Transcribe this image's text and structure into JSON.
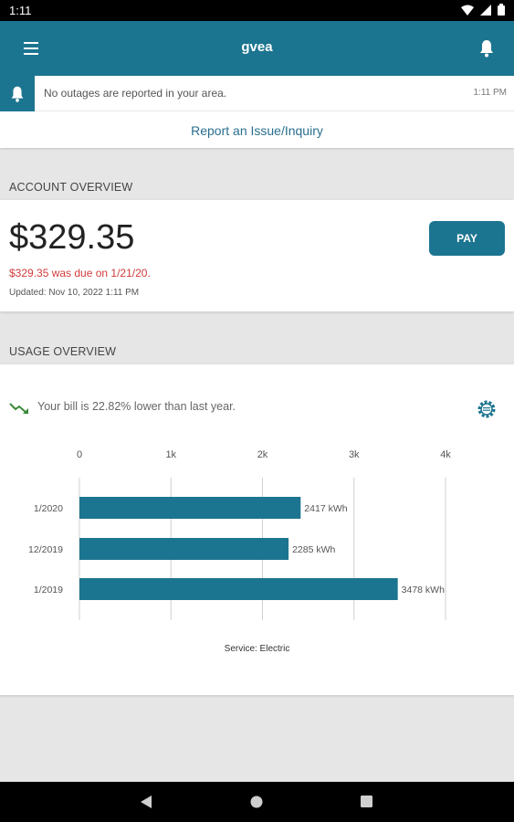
{
  "status_bar": {
    "time": "1:11"
  },
  "app_bar": {
    "title": "gvea"
  },
  "alert": {
    "message": "No outages are reported in your area.",
    "time": "1:11 PM"
  },
  "report_link": "Report an Issue/Inquiry",
  "account": {
    "section_title": "ACCOUNT OVERVIEW",
    "amount": "$329.35",
    "due_text": "$329.35 was due on 1/21/20.",
    "updated": "Updated:  Nov 10, 2022 1:11 PM",
    "pay_label": "PAY"
  },
  "usage": {
    "section_title": "USAGE OVERVIEW",
    "trend_text": "Your bill is 22.82% lower than last year.",
    "service_label": "Service: Electric"
  },
  "colors": {
    "accent": "#1c7590",
    "due_red": "#d23a3a"
  },
  "chart_data": {
    "type": "bar",
    "orientation": "horizontal",
    "categories": [
      "1/2020",
      "12/2019",
      "1/2019"
    ],
    "values": [
      2417,
      2285,
      3478
    ],
    "data_labels": [
      "2417 kWh",
      "2285 kWh",
      "3478 kWh"
    ],
    "x_ticks": [
      0,
      1000,
      2000,
      3000,
      4000
    ],
    "x_tick_labels": [
      "0",
      "1k",
      "2k",
      "3k",
      "4k"
    ],
    "xlim": [
      0,
      4000
    ],
    "grid": true,
    "color": "#1c7590"
  }
}
